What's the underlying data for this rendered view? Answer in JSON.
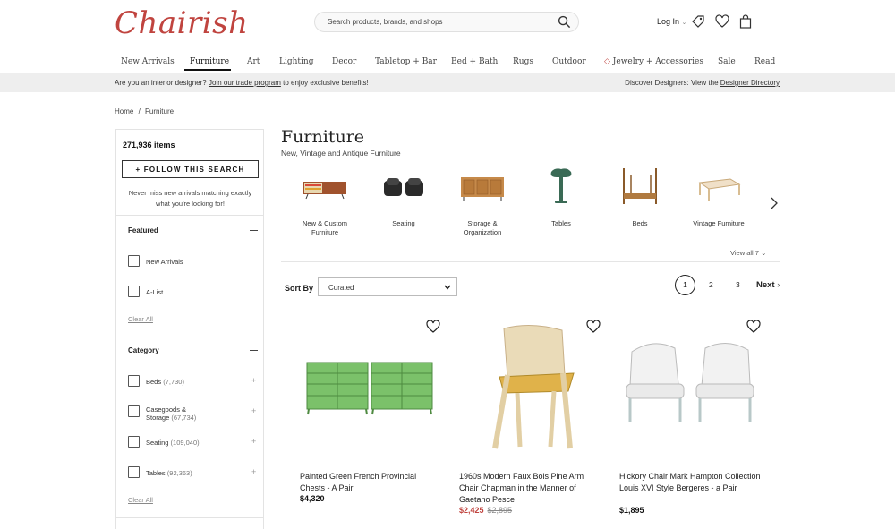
{
  "header": {
    "logo": "Chairish",
    "search_placeholder": "Search products, brands, and shops",
    "login": "Log In"
  },
  "nav": [
    "New Arrivals",
    "Furniture",
    "Art",
    "Lighting",
    "Decor",
    "Tabletop + Bar",
    "Bed + Bath",
    "Rugs",
    "Outdoor",
    "Jewelry + Accessories",
    "Sale",
    "Read"
  ],
  "banner": {
    "left_prefix": "Are you an interior designer?",
    "left_link": "Join our trade program",
    "left_suffix": "to enjoy exclusive benefits!",
    "right_prefix": "Discover Designers: View the",
    "right_link": "Designer Directory"
  },
  "breadcrumb": {
    "home": "Home",
    "sep": "/",
    "current": "Furniture"
  },
  "sidebar": {
    "count": "271,936 items",
    "follow": "+ FOLLOW THIS SEARCH",
    "follow_note": "Never miss new arrivals matching exactly what you're looking for!",
    "featured_title": "Featured",
    "featured": [
      "New Arrivals",
      "A-List"
    ],
    "clear": "Clear All",
    "category_title": "Category",
    "categories": [
      {
        "name": "Beds",
        "count": "(7,730)"
      },
      {
        "name": "Casegoods & Storage",
        "count": "(67,734)"
      },
      {
        "name": "Seating",
        "count": "(109,040)"
      },
      {
        "name": "Tables",
        "count": "(92,363)"
      }
    ],
    "plus": "+"
  },
  "main": {
    "title": "Furniture",
    "subtitle": "New, Vintage and Antique Furniture",
    "categories": [
      "New & Custom Furniture",
      "Seating",
      "Storage & Organization",
      "Tables",
      "Beds",
      "Vintage Furniture"
    ],
    "view_all": "View all 7",
    "sort_label": "Sort By",
    "sort_value": "Curated",
    "pages": [
      "1",
      "2",
      "3"
    ],
    "next": "Next"
  },
  "products": [
    {
      "title": "Painted Green French Provincial Chests - A Pair",
      "price": "$4,320",
      "original": ""
    },
    {
      "title": "1960s Modern Faux Bois Pine Arm Chair Chapman in the Manner of Gaetano Pesce",
      "price": "$2,425",
      "original": "$2,895"
    },
    {
      "title": "Hickory Chair Mark Hampton Collection Louis XVI Style Bergeres - a Pair",
      "price": "$1,895",
      "original": ""
    }
  ],
  "colors": {
    "brand": "#c0443f",
    "banner": "#eeeeee"
  }
}
